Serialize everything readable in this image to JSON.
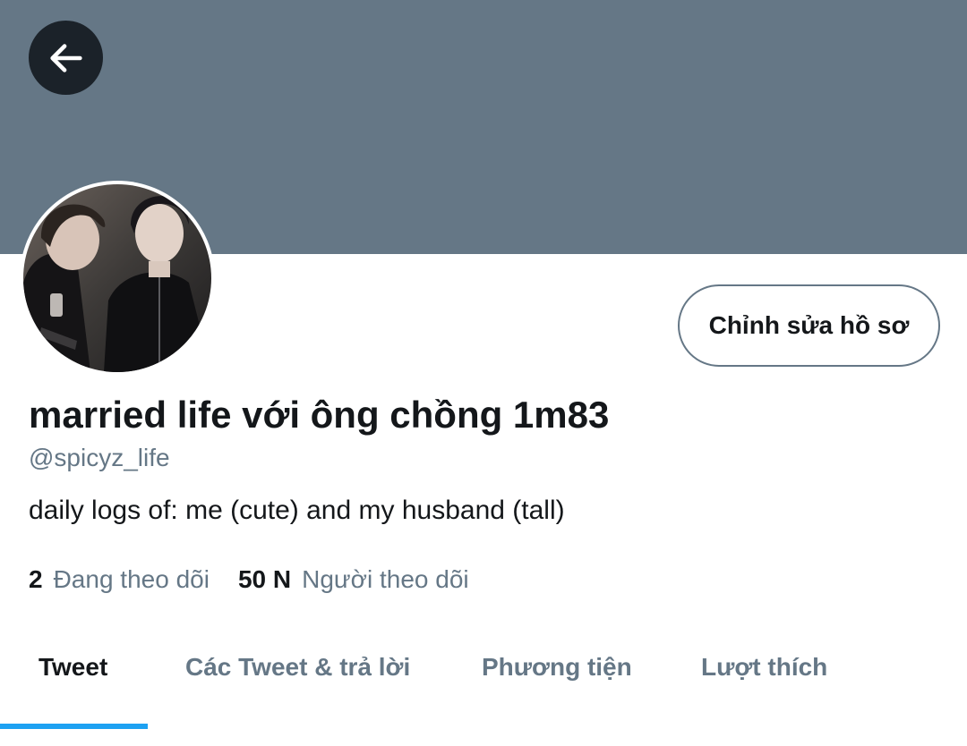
{
  "header": {
    "banner_color": "#657786",
    "back_icon": "arrow-left-icon"
  },
  "profile": {
    "edit_button_label": "Chỉnh sửa hồ sơ",
    "display_name": "married life với ông chồng 1m83",
    "handle": "@spicyz_life",
    "bio": "daily logs of: me (cute) and my husband (tall)",
    "following_count": "2",
    "following_label": "Đang theo dõi",
    "followers_count": "50 N",
    "followers_label": "Người theo dõi"
  },
  "tabs": [
    {
      "label": "Tweet",
      "active": true
    },
    {
      "label": "Các Tweet & trả lời",
      "active": false
    },
    {
      "label": "Phương tiện",
      "active": false
    },
    {
      "label": "Lượt thích",
      "active": false
    }
  ],
  "colors": {
    "accent": "#1da1f2",
    "text_primary": "#14171a",
    "text_secondary": "#657786"
  }
}
